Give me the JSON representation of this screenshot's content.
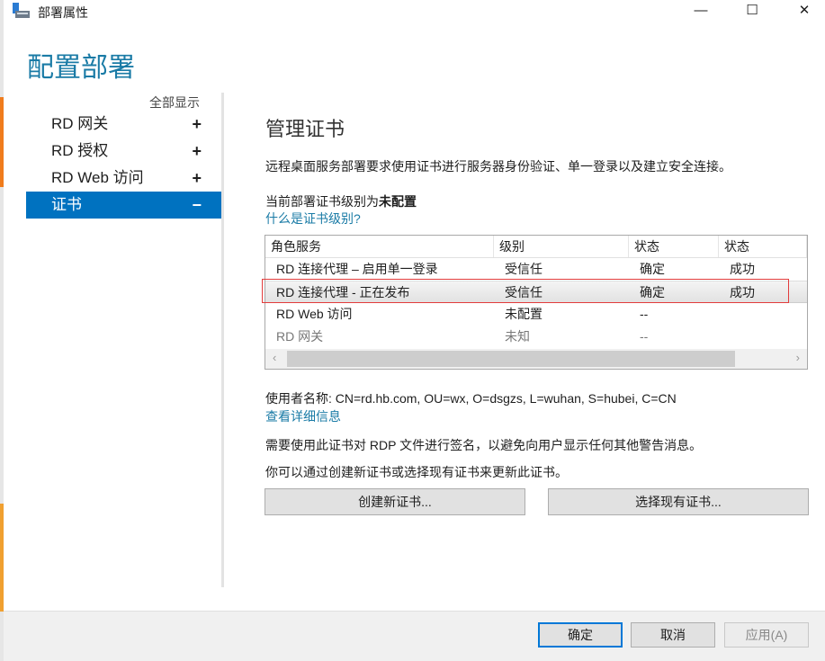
{
  "window": {
    "title": "部署属性",
    "minimize": "—",
    "maximize": "☐",
    "close": "✕"
  },
  "heading": "配置部署",
  "sidebar": {
    "show_all": "全部显示",
    "items": [
      {
        "label": "RD 网关",
        "toggle": "+"
      },
      {
        "label": "RD 授权",
        "toggle": "+"
      },
      {
        "label": "RD Web 访问",
        "toggle": "+"
      },
      {
        "label": "证书",
        "toggle": "−"
      }
    ]
  },
  "main": {
    "title": "管理证书",
    "description": "远程桌面服务部署要求使用证书进行服务器身份验证、单一登录以及建立安全连接。",
    "level_prefix": "当前部署证书级别为",
    "level_value": "未配置",
    "level_link": "什么是证书级别?",
    "columns": [
      "角色服务",
      "级别",
      "状态",
      "状态"
    ],
    "rows": [
      [
        "RD 连接代理 – 启用单一登录",
        "受信任",
        "确定",
        "成功"
      ],
      [
        "RD 连接代理 - 正在发布",
        "受信任",
        "确定",
        "成功"
      ],
      [
        "RD Web 访问",
        "未配置",
        "--",
        ""
      ],
      [
        "RD 网关",
        "未知",
        "--",
        ""
      ]
    ],
    "subject": "使用者名称: CN=rd.hb.com, OU=wx, O=dsgzs, L=wuhan, S=hubei, C=CN",
    "details_link": "查看详细信息",
    "sign_note": "需要使用此证书对 RDP 文件进行签名，以避免向用户显示任何其他警告消息。",
    "update_note": "你可以通过创建新证书或选择现有证书来更新此证书。",
    "create_button": "创建新证书...",
    "select_button": "选择现有证书..."
  },
  "footer": {
    "ok": "确定",
    "cancel": "取消",
    "apply": "应用(A)"
  }
}
